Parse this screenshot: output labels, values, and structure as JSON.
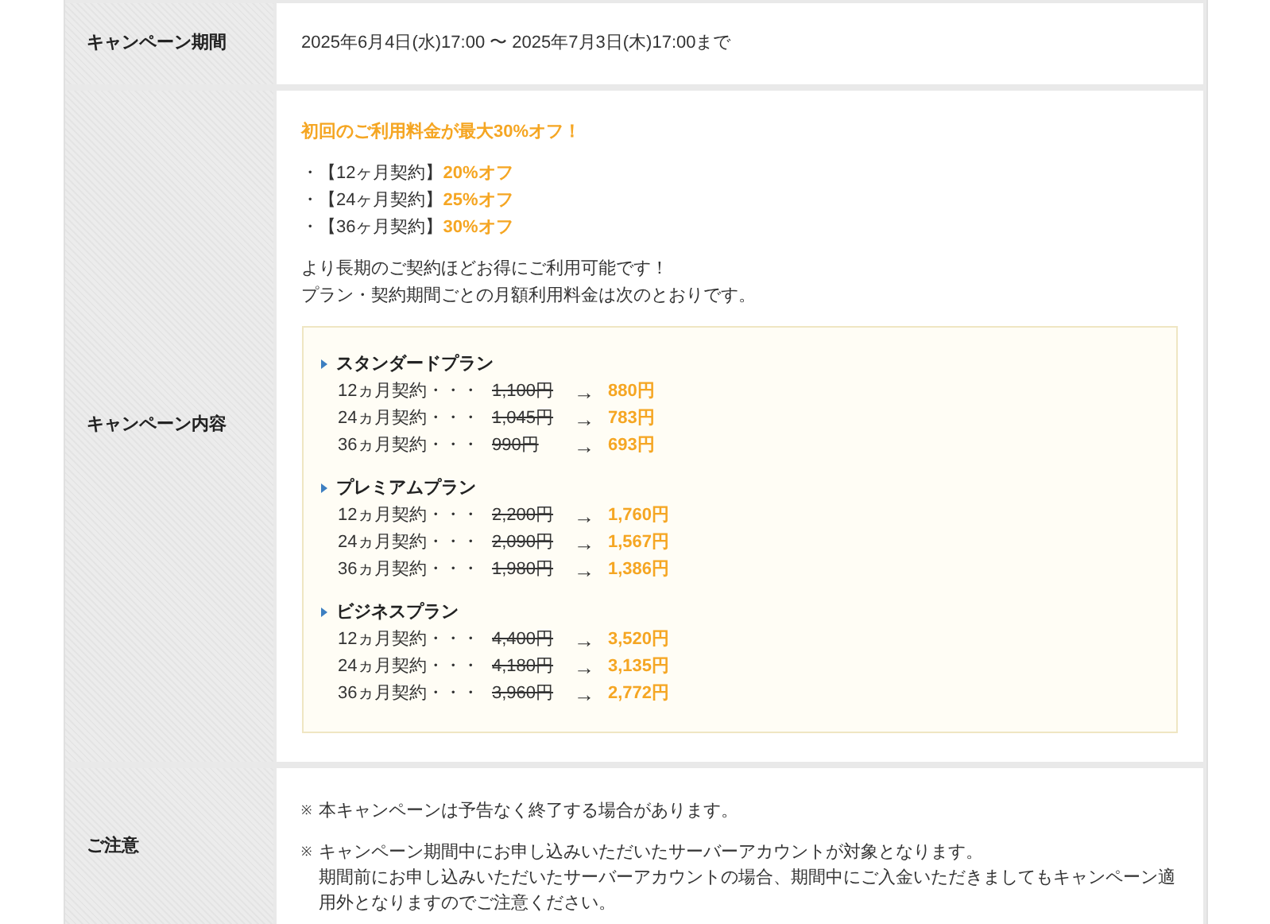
{
  "rows": [
    {
      "kind": "period",
      "label": "キャンペーン期間",
      "text": "2025年6月4日(水)17:00 〜 2025年7月3日(木)17:00まで"
    },
    {
      "kind": "campaign",
      "label": "キャンペーン内容",
      "headline": "初回のご利用料金が最大30%オフ！",
      "discounts": [
        {
          "term": "・【12ヶ月契約】",
          "discount": "20%オフ"
        },
        {
          "term": "・【24ヶ月契約】",
          "discount": "25%オフ"
        },
        {
          "term": "・【36ヶ月契約】",
          "discount": "30%オフ"
        }
      ],
      "lines": [
        "より長期のご契約ほどお得にご利用可能です！",
        "プラン・契約期間ごとの月額利用料金は次のとおりです。"
      ],
      "plans": [
        {
          "name": "スタンダードプラン",
          "prices": [
            {
              "term": "12ヵ月契約・・・",
              "old": "1,100円",
              "arrow": "→",
              "new": "880円"
            },
            {
              "term": "24ヵ月契約・・・",
              "old": "1,045円",
              "arrow": "→",
              "new": "783円"
            },
            {
              "term": "36ヵ月契約・・・",
              "old": "990円",
              "arrow": "→",
              "new": "693円"
            }
          ]
        },
        {
          "name": "プレミアムプラン",
          "prices": [
            {
              "term": "12ヵ月契約・・・",
              "old": "2,200円",
              "arrow": "→",
              "new": "1,760円"
            },
            {
              "term": "24ヵ月契約・・・",
              "old": "2,090円",
              "arrow": "→",
              "new": "1,567円"
            },
            {
              "term": "36ヵ月契約・・・",
              "old": "1,980円",
              "arrow": "→",
              "new": "1,386円"
            }
          ]
        },
        {
          "name": "ビジネスプラン",
          "prices": [
            {
              "term": "12ヵ月契約・・・",
              "old": "4,400円",
              "arrow": "→",
              "new": "3,520円"
            },
            {
              "term": "24ヵ月契約・・・",
              "old": "4,180円",
              "arrow": "→",
              "new": "3,135円"
            },
            {
              "term": "36ヵ月契約・・・",
              "old": "3,960円",
              "arrow": "→",
              "new": "2,772円"
            }
          ]
        }
      ]
    },
    {
      "kind": "notes",
      "label": "ご注意",
      "notes": [
        {
          "mark": "※",
          "lines": [
            "本キャンペーンは予告なく終了する場合があります。"
          ]
        },
        {
          "mark": "※",
          "lines": [
            "キャンペーン期間中にお申し込みいただいたサーバーアカウントが対象となります。",
            "期間前にお申し込みいただいたサーバーアカウントの場合、期間中にご入金いただきましてもキャンペーン適用外となりますのでご注意ください。"
          ]
        }
      ]
    }
  ]
}
